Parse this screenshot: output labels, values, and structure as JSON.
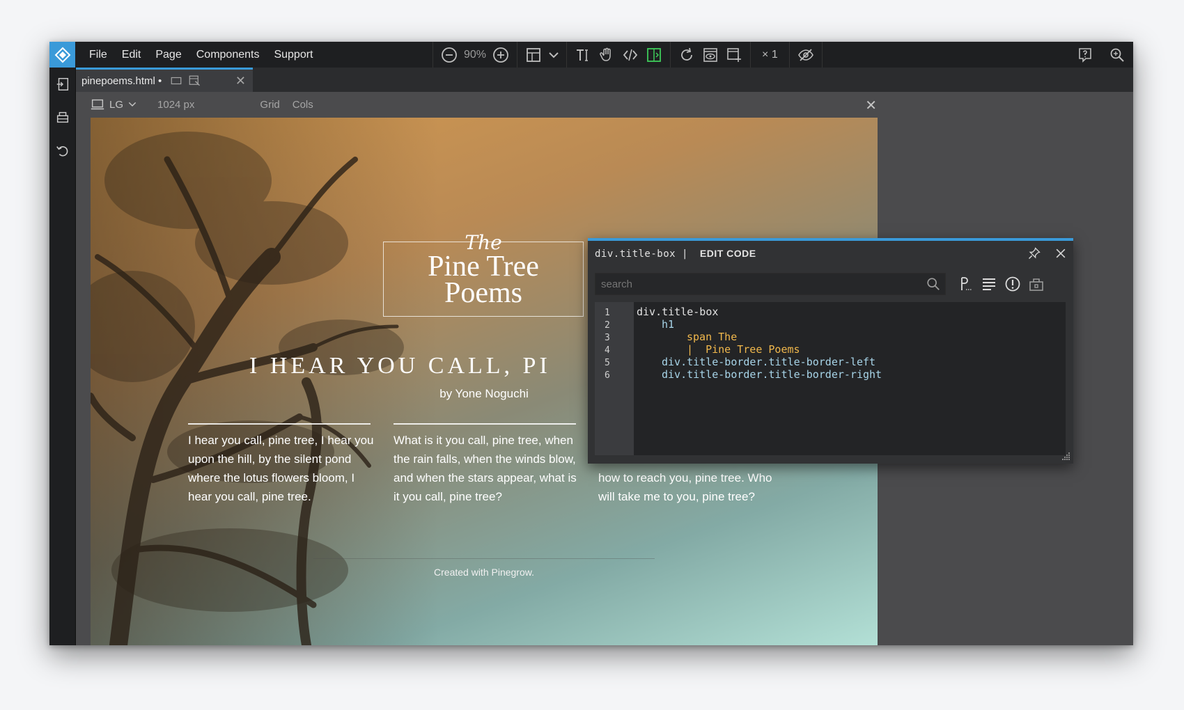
{
  "menubar": {
    "items": [
      "File",
      "Edit",
      "Page",
      "Components",
      "Support"
    ],
    "zoom": "90%",
    "multiplier": "× 1"
  },
  "tab": {
    "filename": "pinepoems.html •"
  },
  "canvas": {
    "device": "LG",
    "width": "1024 px",
    "grid": "Grid",
    "cols": "Cols"
  },
  "preview": {
    "title_the": "The",
    "title_line1": "Pine Tree",
    "title_line2": "Poems",
    "heading": "I HEAR YOU CALL, PI",
    "byline": "by Yone Noguchi",
    "col1": "I hear you call, pine tree, I hear you upon the hill, by the silent pond where the lotus flowers bloom, I hear you call, pine tree.",
    "col2": "What is it you call, pine tree, when the rain falls, when the winds blow, and when the stars appear, what is it you call, pine tree?",
    "col3": "how to reach you, pine tree. Who will take me to you, pine tree?",
    "footer": "Created with Pinegrow."
  },
  "editor": {
    "selector": "div.title-box",
    "label": "EDIT CODE",
    "search_placeholder": "search",
    "lines": [
      {
        "n": "1",
        "text": "div.title-box",
        "kind": "tag",
        "indent": 0
      },
      {
        "n": "2",
        "text": "h1",
        "kind": "cls",
        "indent": 1
      },
      {
        "n": "3",
        "text": "span The",
        "kind": "txt",
        "indent": 2
      },
      {
        "n": "4",
        "text": "|  Pine Tree Poems",
        "kind": "txt",
        "indent": 2
      },
      {
        "n": "5",
        "text": "div.title-border.title-border-left",
        "kind": "cls",
        "indent": 1
      },
      {
        "n": "6",
        "text": "div.title-border.title-border-right",
        "kind": "cls",
        "indent": 1
      }
    ]
  },
  "colors": {
    "accent": "#3a9ad9",
    "code_text": "#f1b84c",
    "code_class": "#a7d4e8"
  },
  "icons": [
    "pinegrow-logo-icon",
    "zoom-out-icon",
    "zoom-in-icon",
    "layout-icon",
    "chevron-down-icon",
    "text-icon",
    "hand-icon",
    "code-icon",
    "split-icon",
    "refresh-icon",
    "preview-icon",
    "save-icon",
    "visibility-off-icon",
    "help-icon",
    "search-icon",
    "import-icon",
    "print-icon",
    "undo-icon",
    "pin-icon",
    "close-icon"
  ]
}
